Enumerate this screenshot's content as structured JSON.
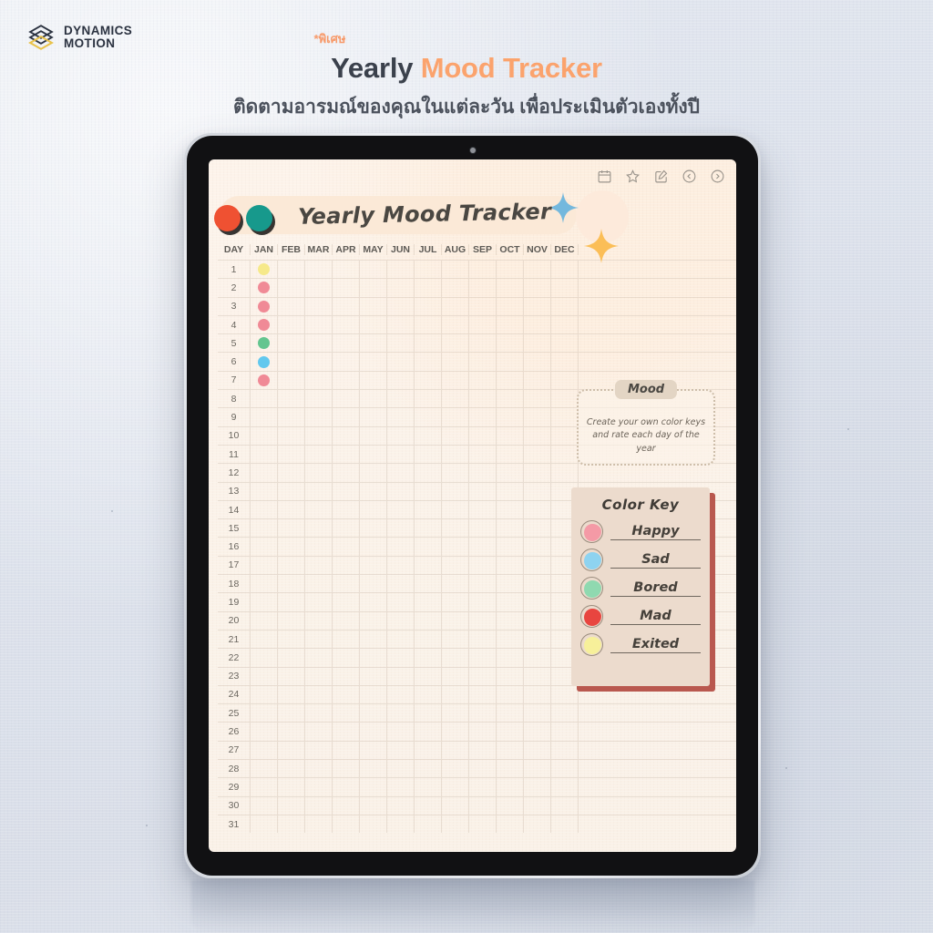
{
  "brand": {
    "line1": "DYNAMICS",
    "line2": "MOTION",
    "logo_icon": "stacked-hexagon-logo"
  },
  "header": {
    "kicker": "*พิเศษ",
    "title_part1": "Yearly ",
    "title_part2": "Mood Tracker",
    "subtitle": "ติดตามอารมณ์ของคุณในแต่ละวัน เพื่อประเมินตัวเองทั้งปี",
    "kicker_color": "#f79a6a",
    "title_color_1": "#3b414c",
    "title_color_2": "#fba36d"
  },
  "device": {
    "type": "tablet",
    "bezel_color": "#111113",
    "frame_color": "#dfe3e9"
  },
  "toolbar": {
    "icons": [
      "calendar-icon",
      "star-icon",
      "compose-icon",
      "prev-page-icon",
      "next-page-icon"
    ]
  },
  "page": {
    "title": "Yearly Mood Tracker",
    "tab_dots": [
      {
        "name": "red-tab-dot",
        "color": "#ef5132"
      },
      {
        "name": "teal-tab-dot",
        "color": "#17998c"
      }
    ],
    "sparkles": [
      {
        "name": "blue-sparkle",
        "color": "#74b8dd"
      },
      {
        "name": "yellow-sparkle",
        "color": "#fbbe57"
      }
    ],
    "band_color": "#fbe9d7"
  },
  "table": {
    "columns": [
      "DAY",
      "JAN",
      "FEB",
      "MAR",
      "APR",
      "MAY",
      "JUN",
      "JUL",
      "AUG",
      "SEP",
      "OCT",
      "NOV",
      "DEC"
    ],
    "days": [
      1,
      2,
      3,
      4,
      5,
      6,
      7,
      8,
      9,
      10,
      11,
      12,
      13,
      14,
      15,
      16,
      17,
      18,
      19,
      20,
      21,
      22,
      23,
      24,
      25,
      26,
      27,
      28,
      29,
      30,
      31
    ],
    "entries": [
      {
        "day": 1,
        "month": "JAN",
        "color": "#f6e98a",
        "mood": "Exited"
      },
      {
        "day": 2,
        "month": "JAN",
        "color": "#f08a96",
        "mood": "Happy"
      },
      {
        "day": 3,
        "month": "JAN",
        "color": "#f08a96",
        "mood": "Happy"
      },
      {
        "day": 4,
        "month": "JAN",
        "color": "#f08a96",
        "mood": "Happy"
      },
      {
        "day": 5,
        "month": "JAN",
        "color": "#63c58f",
        "mood": "Bored"
      },
      {
        "day": 6,
        "month": "JAN",
        "color": "#62c8ee",
        "mood": "Sad"
      },
      {
        "day": 7,
        "month": "JAN",
        "color": "#f08a96",
        "mood": "Happy"
      }
    ]
  },
  "mood_note": {
    "label": "Mood",
    "text": "Create your own color keys and rate each day of the year"
  },
  "color_key": {
    "title": "Color Key",
    "items": [
      {
        "label": "Happy",
        "color": "#f49aa6"
      },
      {
        "label": "Sad",
        "color": "#8ed3f0"
      },
      {
        "label": "Bored",
        "color": "#8fd9b0"
      },
      {
        "label": "Mad",
        "color": "#e8453f"
      },
      {
        "label": "Exited",
        "color": "#f7f09a"
      }
    ],
    "card_color": "#ecdbcd",
    "shadow_color": "#b9584f"
  }
}
